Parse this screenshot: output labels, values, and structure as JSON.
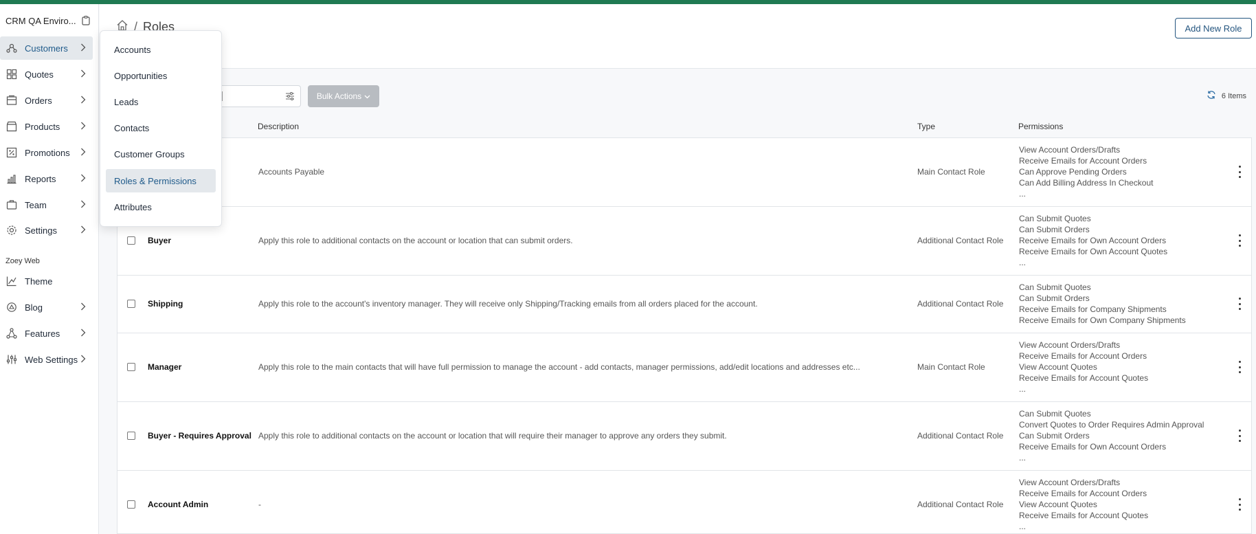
{
  "sidebar": {
    "brand": "CRM QA Enviro...",
    "section_label": "Zoey Web",
    "items": [
      {
        "label": "Customers",
        "icon": "users-icon",
        "active": true
      },
      {
        "label": "Quotes",
        "icon": "quotes-icon"
      },
      {
        "label": "Orders",
        "icon": "orders-icon"
      },
      {
        "label": "Products",
        "icon": "products-icon"
      },
      {
        "label": "Promotions",
        "icon": "percent-icon"
      },
      {
        "label": "Reports",
        "icon": "chart-icon"
      },
      {
        "label": "Team",
        "icon": "team-icon"
      },
      {
        "label": "Settings",
        "icon": "gear-icon"
      },
      {
        "label": "Theme",
        "icon": "theme-icon"
      },
      {
        "label": "Blog",
        "icon": "blog-icon"
      },
      {
        "label": "Features",
        "icon": "features-icon"
      },
      {
        "label": "Web Settings",
        "icon": "sliders-icon"
      }
    ]
  },
  "flyout": {
    "items": [
      {
        "label": "Accounts"
      },
      {
        "label": "Opportunities"
      },
      {
        "label": "Leads"
      },
      {
        "label": "Contacts"
      },
      {
        "label": "Customer Groups"
      },
      {
        "label": "Roles & Permissions",
        "active": true
      },
      {
        "label": "Attributes"
      }
    ]
  },
  "header": {
    "breadcrumb_current": "Roles",
    "breadcrumb_separator": "/",
    "add_button": "Add New Role"
  },
  "toolbar": {
    "bulk_actions": "Bulk Actions",
    "items_count": "6 Items"
  },
  "table": {
    "columns": {
      "description": "Description",
      "type": "Type",
      "permissions": "Permissions"
    },
    "rows": [
      {
        "name": "",
        "description": "Accounts Payable",
        "type": "Main Contact Role",
        "permissions": [
          "View Account Orders/Drafts",
          "Receive Emails for Account Orders",
          "Can Approve Pending Orders",
          "Can Add Billing Address In Checkout",
          "..."
        ]
      },
      {
        "name": "Buyer",
        "description": "Apply this role to additional contacts on the account or location that can submit orders.",
        "type": "Additional Contact Role",
        "permissions": [
          "Can Submit Quotes",
          "Can Submit Orders",
          "Receive Emails for Own Account Orders",
          "Receive Emails for Own Account Quotes",
          "..."
        ]
      },
      {
        "name": "Shipping",
        "description": "Apply this role to the account's inventory manager. They will receive only Shipping/Tracking emails from all orders placed for the account.",
        "type": "Additional Contact Role",
        "permissions": [
          "Can Submit Quotes",
          "Can Submit Orders",
          "Receive Emails for Company Shipments",
          "Receive Emails for Own Company Shipments"
        ]
      },
      {
        "name": "Manager",
        "description": "Apply this role to the main contacts that will have full permission to manage the account - add contacts, manager permissions, add/edit locations and addresses etc...",
        "type": "Main Contact Role",
        "permissions": [
          "View Account Orders/Drafts",
          "Receive Emails for Account Orders",
          "View Account Quotes",
          "Receive Emails for Account Quotes",
          "..."
        ]
      },
      {
        "name": "Buyer - Requires Approval",
        "description": "Apply this role to additional contacts on the account or location that will require their manager to approve any orders they submit.",
        "type": "Additional Contact Role",
        "permissions": [
          "Can Submit Quotes",
          "Convert Quotes to Order Requires Admin Approval",
          "Can Submit Orders",
          "Receive Emails for Own Account Orders",
          "..."
        ]
      },
      {
        "name": "Account Admin",
        "description": "-",
        "type": "Additional Contact Role",
        "permissions": [
          "View Account Orders/Drafts",
          "Receive Emails for Account Orders",
          "View Account Quotes",
          "Receive Emails for Account Quotes",
          "..."
        ]
      }
    ]
  }
}
